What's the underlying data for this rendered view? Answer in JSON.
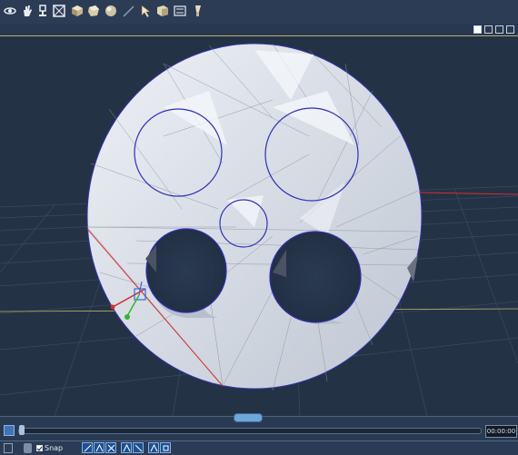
{
  "toolbar": {
    "tools": [
      {
        "name": "rotate-camera-icon"
      },
      {
        "name": "pan-hand-icon"
      },
      {
        "name": "podium-icon"
      },
      {
        "name": "frame-box-icon"
      },
      {
        "name": "cube-icon"
      },
      {
        "name": "cube-tilt-icon"
      },
      {
        "name": "sphere-icon"
      },
      {
        "name": "line-icon"
      },
      {
        "name": "select-arrow-icon"
      },
      {
        "name": "object-box-icon"
      },
      {
        "name": "transform-icon"
      },
      {
        "name": "paint-icon"
      }
    ]
  },
  "view_buttons": [
    "single-view",
    "two-view",
    "three-view",
    "four-view"
  ],
  "timeline": {
    "time": "00:00:00"
  },
  "statusbar": {
    "snap_label": "Snap",
    "snap_checked": true
  },
  "colors": {
    "background": "#243246",
    "mesh_face": "#d6dbe4",
    "hole_edge": "#2f2fb5",
    "x_axis": "#d42f2f",
    "y_axis": "#2fb82f"
  }
}
